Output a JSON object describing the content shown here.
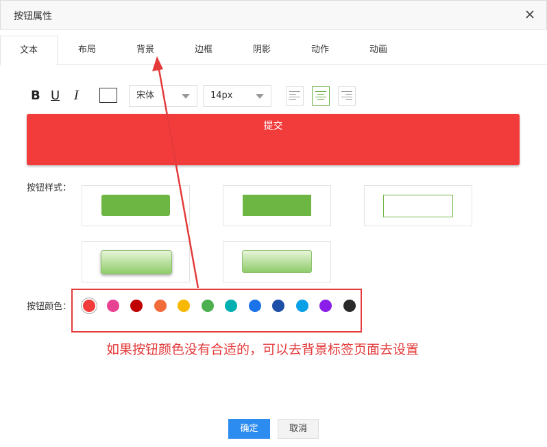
{
  "dialog": {
    "title": "按钮属性"
  },
  "tabs": [
    {
      "label": "文本",
      "active": true
    },
    {
      "label": "布局"
    },
    {
      "label": "背景"
    },
    {
      "label": "边框"
    },
    {
      "label": "阴影"
    },
    {
      "label": "动作"
    },
    {
      "label": "动画"
    }
  ],
  "toolbar": {
    "bold": "B",
    "underline": "U",
    "italic": "I",
    "font": "宋体",
    "size": "14px",
    "align_selected": "center"
  },
  "preview": {
    "label": "提交",
    "color": "#f23c3c"
  },
  "button_style": {
    "label": "按钮样式："
  },
  "button_color": {
    "label": "按钮颜色：",
    "selected_index": 0,
    "colors": [
      "#f23c3c",
      "#e84393",
      "#c00000",
      "#f26b3a",
      "#f7b800",
      "#4caf50",
      "#00b0b0",
      "#1a73e8",
      "#1e4fa8",
      "#0aa0e8",
      "#8a1ee8",
      "#2a2a2a"
    ]
  },
  "annotation": {
    "text": "如果按钮颜色没有合适的，可以去背景标签页面去设置",
    "color": "#e43a3a"
  },
  "footer": {
    "ok": "确定",
    "cancel": "取消"
  }
}
